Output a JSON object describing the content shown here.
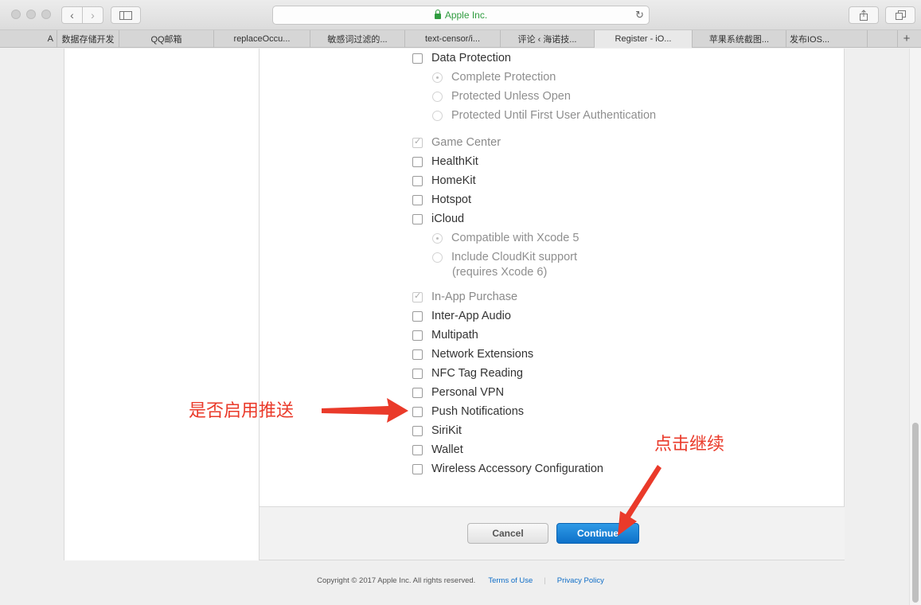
{
  "browser": {
    "url_text": "Apple Inc.",
    "tabs": [
      "A",
      "数据存储开发",
      "QQ邮箱",
      "replaceOccu...",
      "敏感词过滤的...",
      "text-censor/i...",
      "评论 ‹ 海诺技...",
      "Register - iO...",
      "苹果系统截图...",
      "发布IOS..."
    ],
    "new_tab_label": "+"
  },
  "options": {
    "data_protection": "Data Protection",
    "dp_complete": "Complete Protection",
    "dp_unless_open": "Protected Unless Open",
    "dp_first_auth": "Protected Until First User Authentication",
    "game_center": "Game Center",
    "healthkit": "HealthKit",
    "homekit": "HomeKit",
    "hotspot": "Hotspot",
    "icloud": "iCloud",
    "icloud_xcode5": "Compatible with Xcode 5",
    "icloud_cloudkit": "Include CloudKit support",
    "icloud_cloudkit_note": "(requires Xcode 6)",
    "in_app_purchase": "In-App Purchase",
    "inter_app_audio": "Inter-App Audio",
    "multipath": "Multipath",
    "network_extensions": "Network Extensions",
    "nfc": "NFC Tag Reading",
    "personal_vpn": "Personal VPN",
    "push_notifications": "Push Notifications",
    "sirikit": "SiriKit",
    "wallet": "Wallet",
    "wireless_accessory": "Wireless Accessory Configuration"
  },
  "buttons": {
    "cancel": "Cancel",
    "continue": "Continue"
  },
  "footer": {
    "copyright": "Copyright © 2017 Apple Inc. All rights reserved.",
    "terms": "Terms of Use",
    "separator": "|",
    "privacy": "Privacy Policy"
  },
  "annotations": {
    "push": "是否启用推送",
    "continue": "点击继续"
  },
  "colors": {
    "annotation": "#ea3a2a",
    "primary_button": "#1b82d6",
    "secure": "#2f9c3f"
  }
}
